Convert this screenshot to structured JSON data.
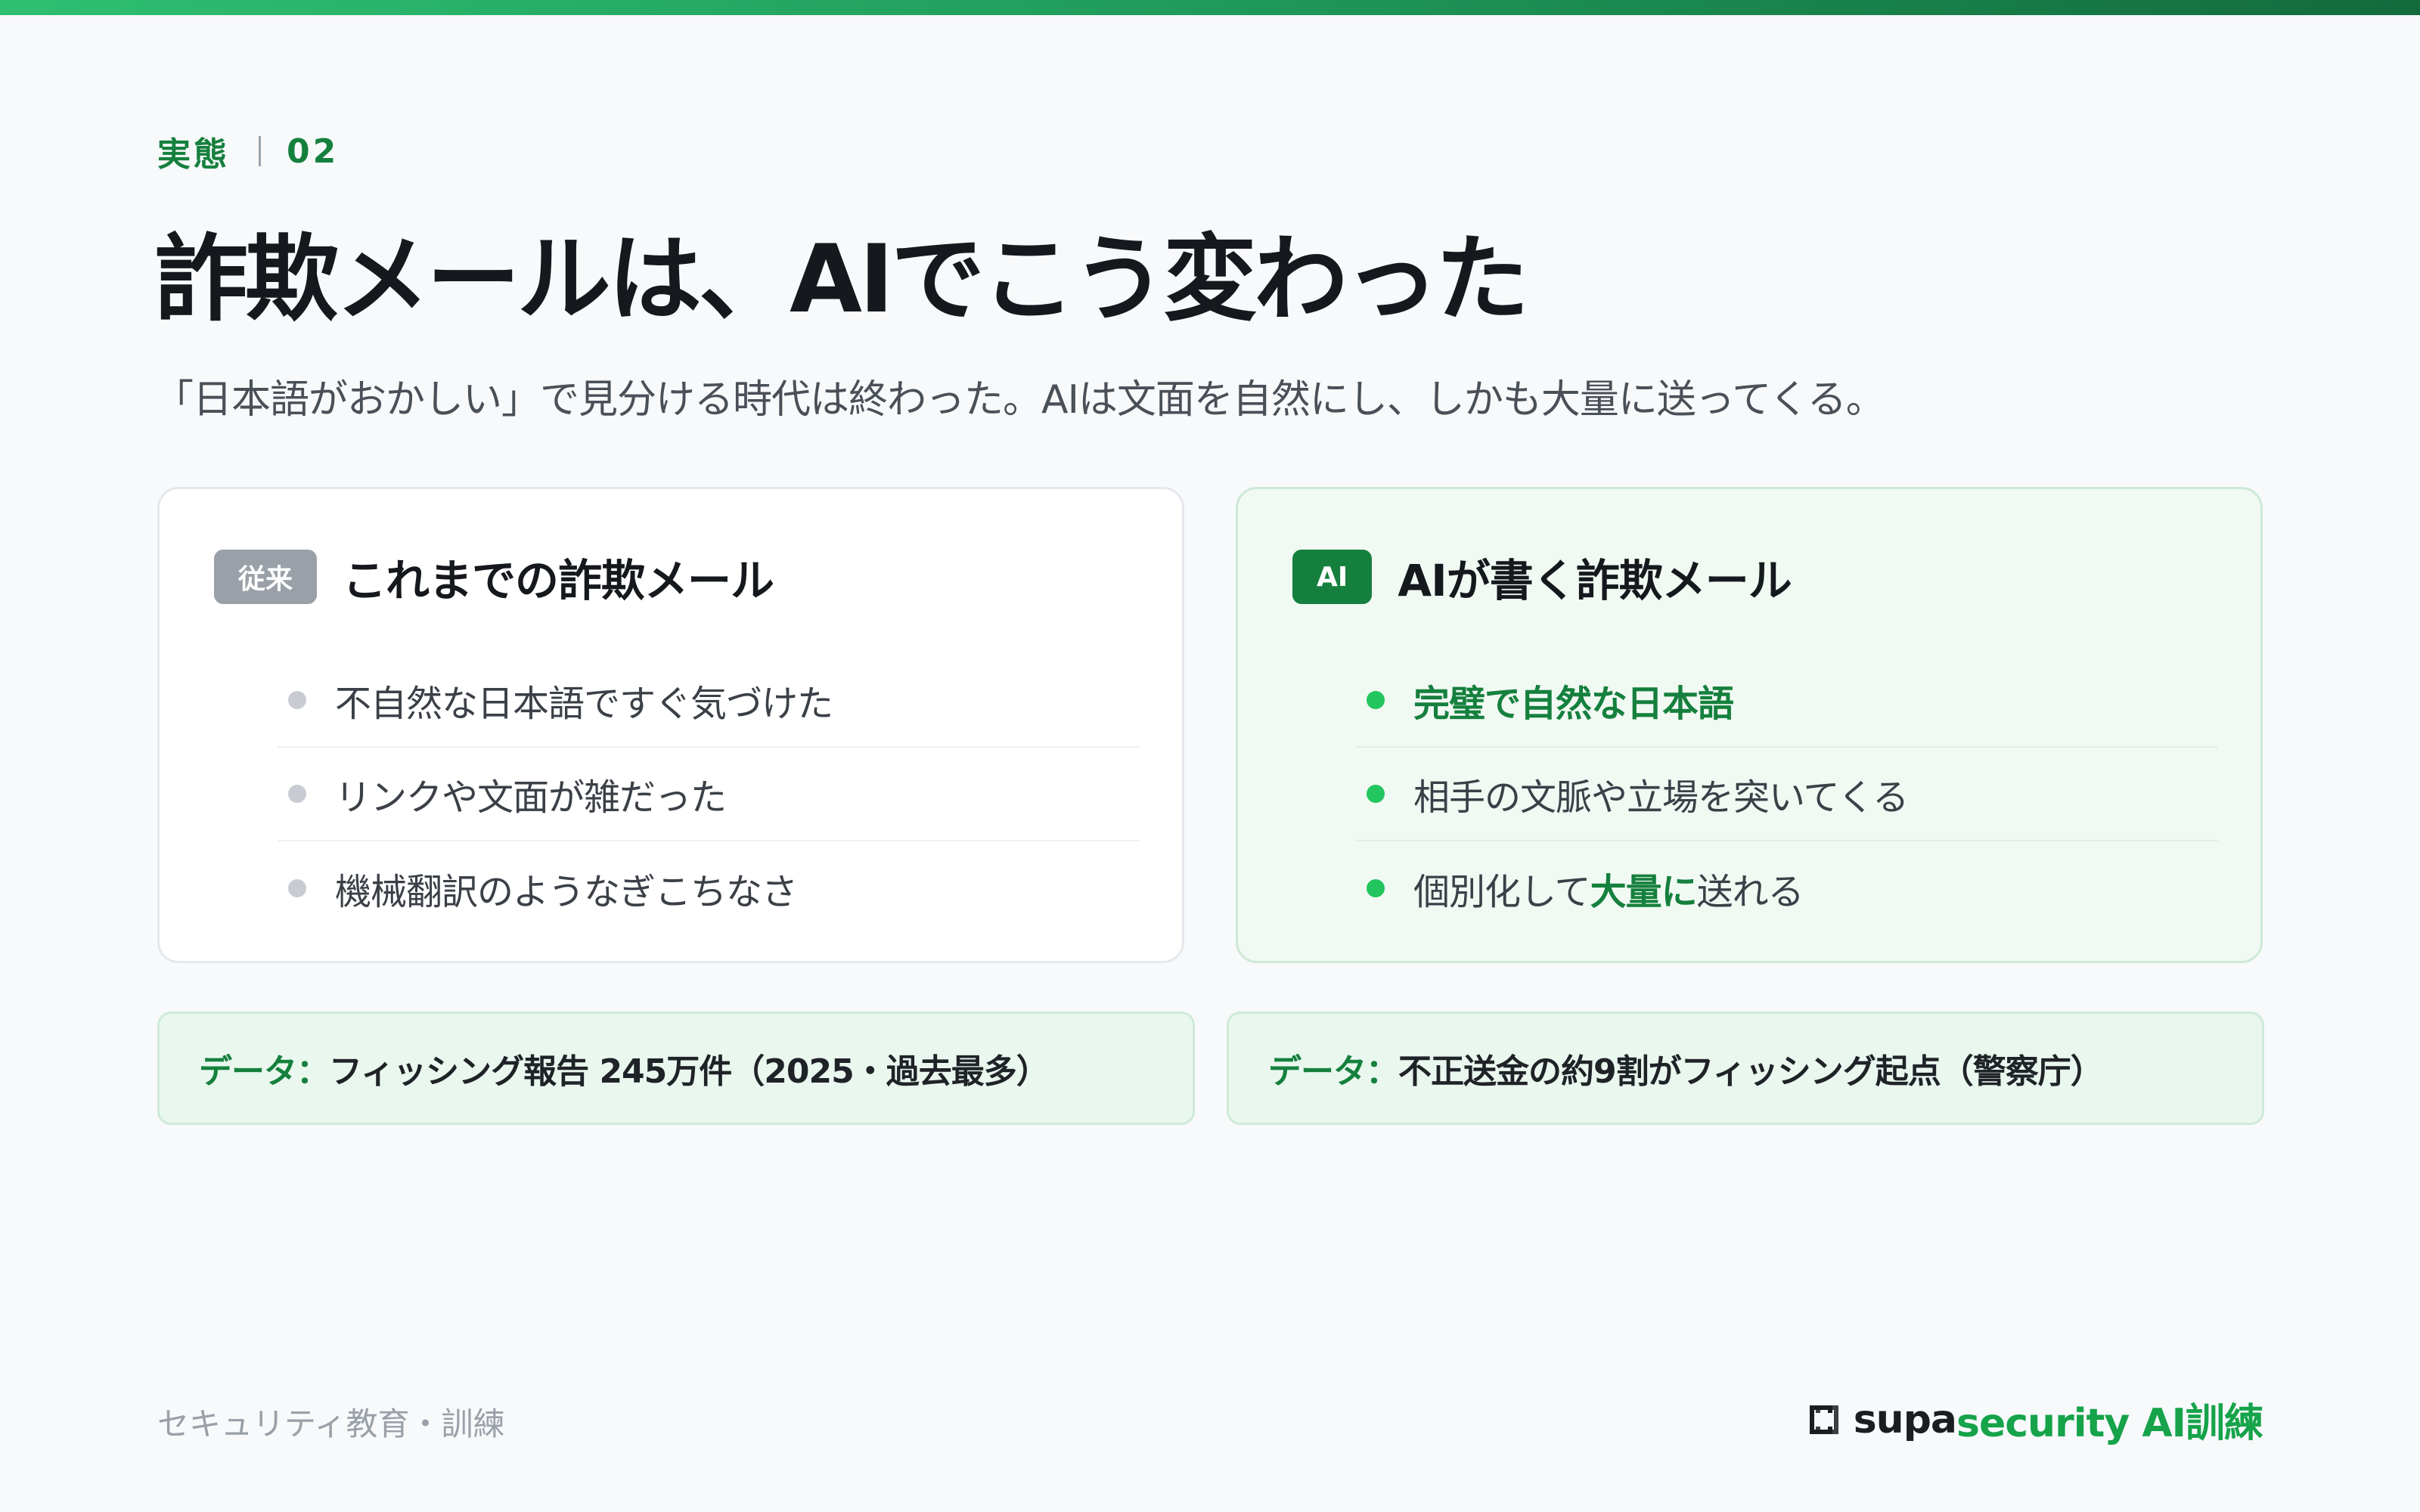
{
  "header": {
    "section": "実態",
    "number": "02",
    "title": "詐欺メールは、AIでこう変わった",
    "subtitle": "「日本語がおかしい」で見分ける時代は終わった。AIは文面を自然にし、しかも大量に送ってくる。"
  },
  "cards": {
    "old": {
      "badge": "従来",
      "title": "これまでの詐欺メール",
      "items": [
        "不自然な日本語ですぐ気づけた",
        "リンクや文面が雑だった",
        "機械翻訳のようなぎこちなさ"
      ]
    },
    "ai": {
      "badge": "AI",
      "title": "AIが書く詐欺メール",
      "items": [
        "完璧で自然な日本語",
        "相手の文脈や立場を突いてくる"
      ],
      "item3": {
        "pre": "個別化して",
        "highlight": "大量に",
        "post": "送れる"
      }
    }
  },
  "data_notes": {
    "left": {
      "label": "データ：",
      "text": "フィッシング報告 245万件（2025・過去最多）"
    },
    "right": {
      "label": "データ：",
      "text": "不正送金の約9割がフィッシング起点（警察庁）"
    }
  },
  "footer": {
    "left": "セキュリティ教育・訓練",
    "brand_part1": "supa",
    "brand_part2": "security AI訓練"
  },
  "colors": {
    "accent": "#15803d",
    "accent_bright": "#22c55e",
    "gray_badge": "#9aa0a8"
  },
  "icons": [
    "brand-logo-icon"
  ]
}
